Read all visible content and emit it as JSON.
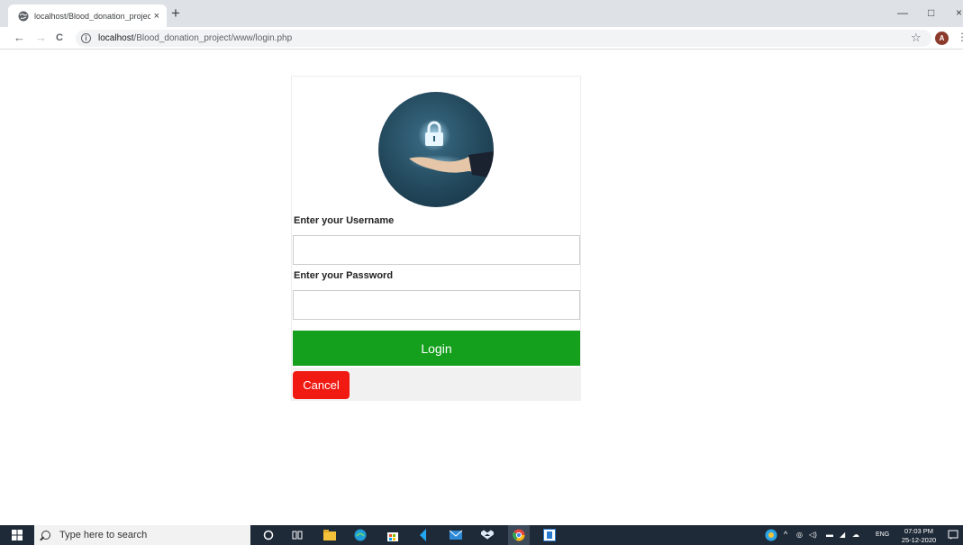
{
  "browser": {
    "tab": {
      "title": "localhost/Blood_donation_projec",
      "close_glyph": "×",
      "favicon": "globe-icon"
    },
    "new_tab_glyph": "+",
    "window_controls": {
      "minimize": "—",
      "maximize": "□",
      "close": "×"
    },
    "nav": {
      "back": "←",
      "forward": "→",
      "reload": "C"
    },
    "address": {
      "info_glyph": "i",
      "host": "localhost",
      "path": "/Blood_donation_project/www/login.php"
    },
    "bookmark_glyph": "☆",
    "profile_initial": "A",
    "menu_glyph": "⋮"
  },
  "login": {
    "logo": "lock-in-hand-icon",
    "username_label": "Enter your Username",
    "username_value": "",
    "password_label": "Enter your Password",
    "password_value": "",
    "login_button": "Login",
    "cancel_button": "Cancel"
  },
  "colors": {
    "login_button": "#14a01c",
    "cancel_button": "#f01a12",
    "cancel_area": "#f1f1f1",
    "taskbar": "#1f2a38"
  },
  "taskbar": {
    "search_placeholder": "Type here to search",
    "apps": [
      "cortana-icon",
      "task-view-icon",
      "file-explorer-icon",
      "edge-icon",
      "store-icon",
      "vscode-icon",
      "mail-icon",
      "dropbox-icon",
      "chrome-icon",
      "app-icon"
    ],
    "tray": {
      "language": "ENG",
      "time": "07:03 PM",
      "date": "25-12-2020"
    }
  }
}
